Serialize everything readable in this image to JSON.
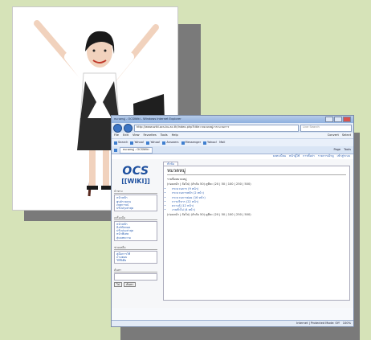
{
  "browser": {
    "window_title": "หมวดหมู่ - OCSWiki - Windows Internet Explorer",
    "address": "http://www.wiki.ocs.ku.ac.th/index.php?title=หมวดหมู่:กระบวนการ",
    "search_placeholder": "Live Search",
    "menu": [
      "File",
      "Edit",
      "View",
      "Favorites",
      "Tools",
      "Help"
    ],
    "menu_right": [
      "Convert",
      "Select"
    ],
    "toolbar_items": [
      "Search",
      "Yahoo!",
      "Yahoo!",
      "Answers",
      "Messenger",
      "Yahoo!",
      "Mail"
    ],
    "tab_label": "หมวดหมู่ - OCSWiki",
    "tab_tools": [
      "Page",
      "Tools"
    ],
    "personal_links": [
      "ลงทะเบียน",
      "หน้าผู้ใช้",
      "การตั้งค่า",
      "รายการเฝ้าดู",
      "เข้าสู่ระบบ"
    ],
    "status": [
      "Internet | Protected Mode: Off",
      "100%"
    ]
  },
  "wiki": {
    "logo_main": "OCS",
    "logo_sub": "[[WIKI]]",
    "tab_page": "หัวข้อ",
    "page_title": "หมวดหมู่",
    "subtitle": "รายชื่อหมวดหมู่",
    "paging": "(ก่อนหน้า | ถัดไป) (ลำดับ 50) ดูทีละ (20 | 50 | 100 | 250 | 500)",
    "items": [
      "กระบวนการ (9 หน้า)",
      "กระบวนการหลัก (2 หน้า)",
      "กระบวนการย่อย (16 หน้า)",
      "การบริหาร (22 หน้า)",
      "ความรู้ (12 หน้า)",
      "งานทั่วไป (4 หน้า)"
    ],
    "paging_bottom": "(ก่อนหน้า | ถัดไป) (ลำดับ 50) ดูทีละ (20 | 50 | 100 | 250 | 500)",
    "sidebar": {
      "nav_header": "นำทาง",
      "nav_items": [
        "หน้าหลัก",
        "ศูนย์รวมคน",
        "เหตุการณ์",
        "ปรับปรุงล่าสุด"
      ],
      "tools_header": "เครื่องมือ",
      "tools_items": [
        "หน้าหลัก",
        "ลิงก์ทั้งหมด",
        "ปรับปรุงล่าสุด",
        "หน้าพิเศษ",
        "สุ่มบทความ"
      ],
      "help_header": "ช่วยเหลือ",
      "help_items": [
        "คู่มือการใช้",
        "ถามตอบ",
        "วิกิพีเดีย"
      ],
      "search_header": "ค้นหา",
      "search_buttons": [
        "ไป",
        "ค้นหา"
      ]
    }
  }
}
